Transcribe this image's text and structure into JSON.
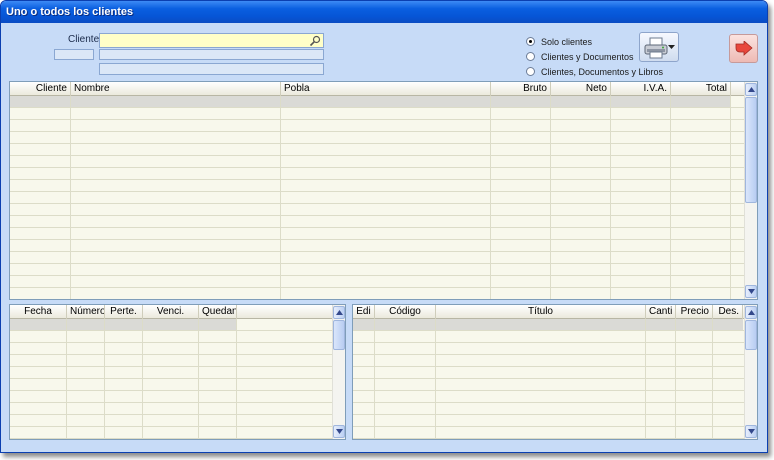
{
  "window": {
    "title": "Uno o todos los clientes"
  },
  "client_filter": {
    "label": "Cliente:",
    "value": "",
    "code_value": "",
    "name_value": "",
    "extra_value": ""
  },
  "scope_options": [
    {
      "label": "Solo clientes",
      "checked": true
    },
    {
      "label": "Clientes y Documentos",
      "checked": false
    },
    {
      "label": "Clientes, Documentos y Libros",
      "checked": false
    }
  ],
  "toolbar": {
    "print_icon": "printer-icon",
    "exit_icon": "exit-arrow-icon"
  },
  "clients_grid": {
    "columns": [
      "Cliente",
      "Nombre",
      "Pobla",
      "Bruto",
      "Neto",
      "I.V.A.",
      "Total"
    ],
    "rows": []
  },
  "documents_grid": {
    "columns": [
      "Fecha",
      "Número",
      "Perte.",
      "Venci.",
      "Quedan"
    ],
    "rows": []
  },
  "books_grid": {
    "columns": [
      "Edi",
      "Código",
      "Título",
      "Canti",
      "Precio",
      "Des."
    ],
    "rows": []
  },
  "colors": {
    "title_bar": "#0655d6",
    "window_bg": "#c7dbf7",
    "grid_bg": "#f8f8ec",
    "client_input": "#ffffc8"
  }
}
